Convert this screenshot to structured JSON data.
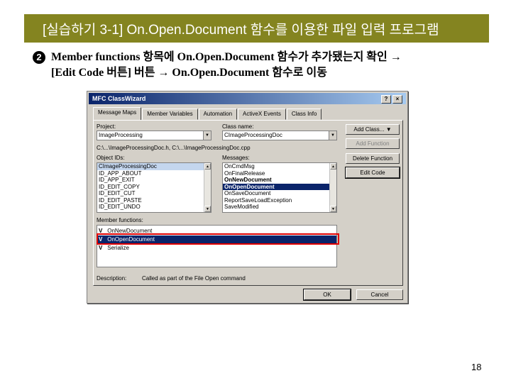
{
  "slide": {
    "title": "[실습하기 3-1] On.Open.Document 함수를 이용한 파일 입력 프로그램",
    "step_number": "2",
    "step_line1": "Member functions 항목에 On.Open.Document 함수가 추가됐는지 확인 →",
    "step_line2": "[Edit Code 버튼] 버튼 → On.Open.Document 함수로 이동",
    "page_number": "18"
  },
  "dialog": {
    "title": "MFC ClassWizard",
    "help_btn": "?",
    "close_btn": "×",
    "tabs": [
      "Message Maps",
      "Member Variables",
      "Automation",
      "ActiveX Events",
      "Class Info"
    ],
    "project_label": "Project:",
    "project_value": "ImageProcessing",
    "classname_label": "Class name:",
    "classname_value": "CImageProcessingDoc",
    "file_path": "C:\\...\\ImageProcessingDoc.h, C:\\...\\ImageProcessingDoc.cpp",
    "objectids_label": "Object IDs:",
    "object_ids": [
      "CImageProcessingDoc",
      "ID_APP_ABOUT",
      "ID_APP_EXIT",
      "ID_EDIT_COPY",
      "ID_EDIT_CUT",
      "ID_EDIT_PASTE",
      "ID_EDIT_UNDO"
    ],
    "messages_label": "Messages:",
    "messages": [
      "OnCmdMsg",
      "OnFinalRelease",
      "OnNewDocument",
      "OnOpenDocument",
      "OnSaveDocument",
      "ReportSaveLoadException",
      "SaveModified"
    ],
    "member_functions_label": "Member functions:",
    "member_functions": [
      {
        "mark": "V",
        "name": "OnNewDocument"
      },
      {
        "mark": "V",
        "name": "OnOpenDocument"
      },
      {
        "mark": "V",
        "name": "Serialize"
      }
    ],
    "description_label": "Description:",
    "description_value": "Called as part of the File Open command",
    "buttons": {
      "add_class": "Add Class...",
      "add_function": "Add Function",
      "delete_function": "Delete Function",
      "edit_code": "Edit Code",
      "ok": "OK",
      "cancel": "Cancel"
    }
  },
  "colors": {
    "banner": "#848420",
    "selection": "#0a246a",
    "highlight_box": "#e00000"
  }
}
